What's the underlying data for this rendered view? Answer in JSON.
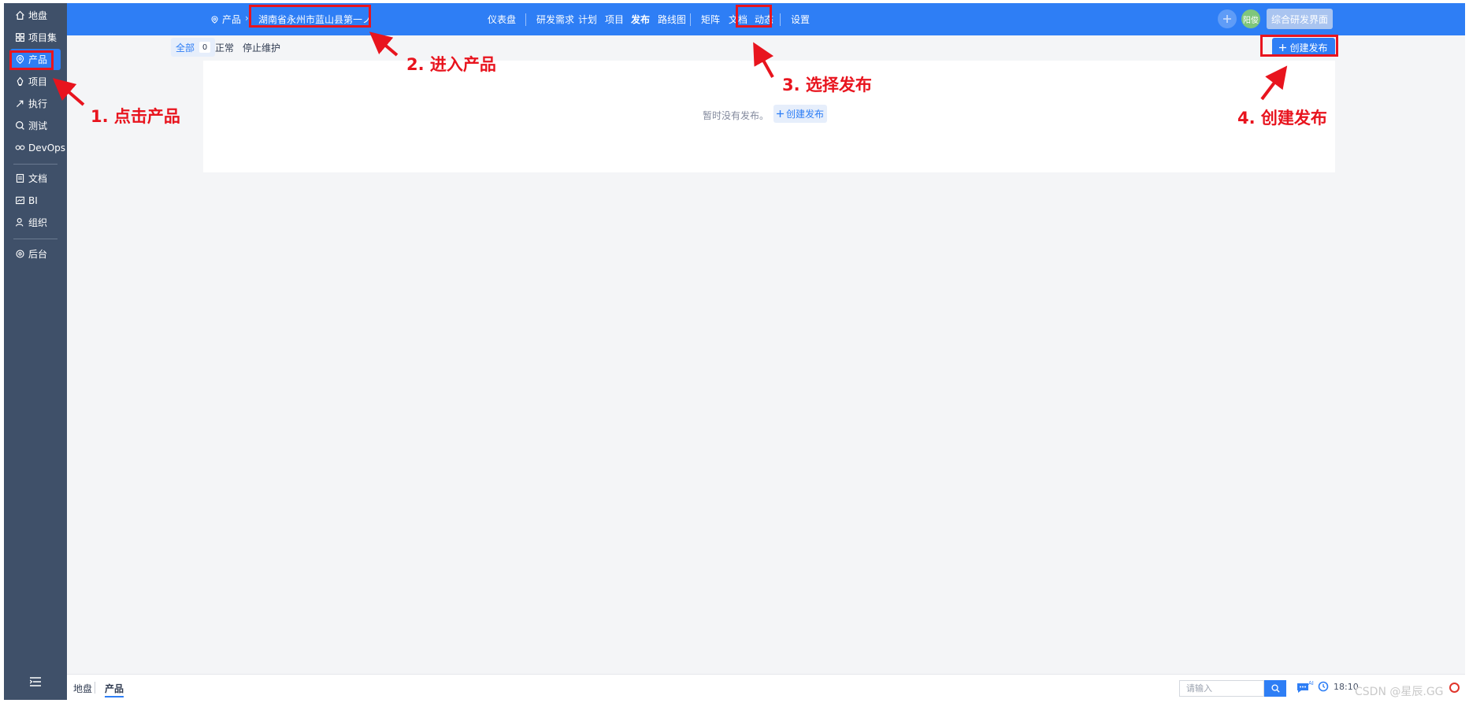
{
  "sidebar": {
    "items": [
      {
        "label": "地盘",
        "icon": "home-icon"
      },
      {
        "label": "项目集",
        "icon": "grid-icon"
      },
      {
        "label": "产品",
        "icon": "product-icon"
      },
      {
        "label": "项目",
        "icon": "project-icon"
      },
      {
        "label": "执行",
        "icon": "run-icon"
      },
      {
        "label": "测试",
        "icon": "test-icon"
      },
      {
        "label": "DevOps",
        "icon": "devops-icon"
      },
      {
        "label": "文档",
        "icon": "doc-icon"
      },
      {
        "label": "BI",
        "icon": "bi-icon"
      },
      {
        "label": "组织",
        "icon": "org-icon"
      },
      {
        "label": "后台",
        "icon": "gear-icon"
      }
    ],
    "active": "产品"
  },
  "header": {
    "crumb": "产品",
    "product_name": "湖南省永州市蓝山县第一ノ",
    "nav": [
      "仪表盘",
      "研发需求",
      "计划",
      "项目",
      "发布",
      "路线图",
      "矩阵",
      "文档",
      "动态",
      "设置"
    ],
    "active_nav": "发布",
    "avatar_text": "阳俊",
    "view_button": "综合研发界面"
  },
  "toolbar": {
    "tabs": [
      {
        "label": "全部",
        "count": "0"
      },
      {
        "label": "正常"
      },
      {
        "label": "停止维护"
      }
    ],
    "create_button": "创建发布"
  },
  "content": {
    "empty_text": "暂时没有发布。",
    "empty_create": "创建发布"
  },
  "footer": {
    "crumbs": [
      "地盘",
      "产品"
    ],
    "search_placeholder": "请输入",
    "ai_label": "AI",
    "time": "18:10"
  },
  "annotations": [
    "1. 点击产品",
    "2. 进入产品",
    "3. 选择发布",
    "4. 创建发布"
  ],
  "watermark": "CSDN @星辰.GG",
  "colors": {
    "primary": "#2e7ef5",
    "sidebar": "#3f5069",
    "annotation": "#e8141e"
  }
}
